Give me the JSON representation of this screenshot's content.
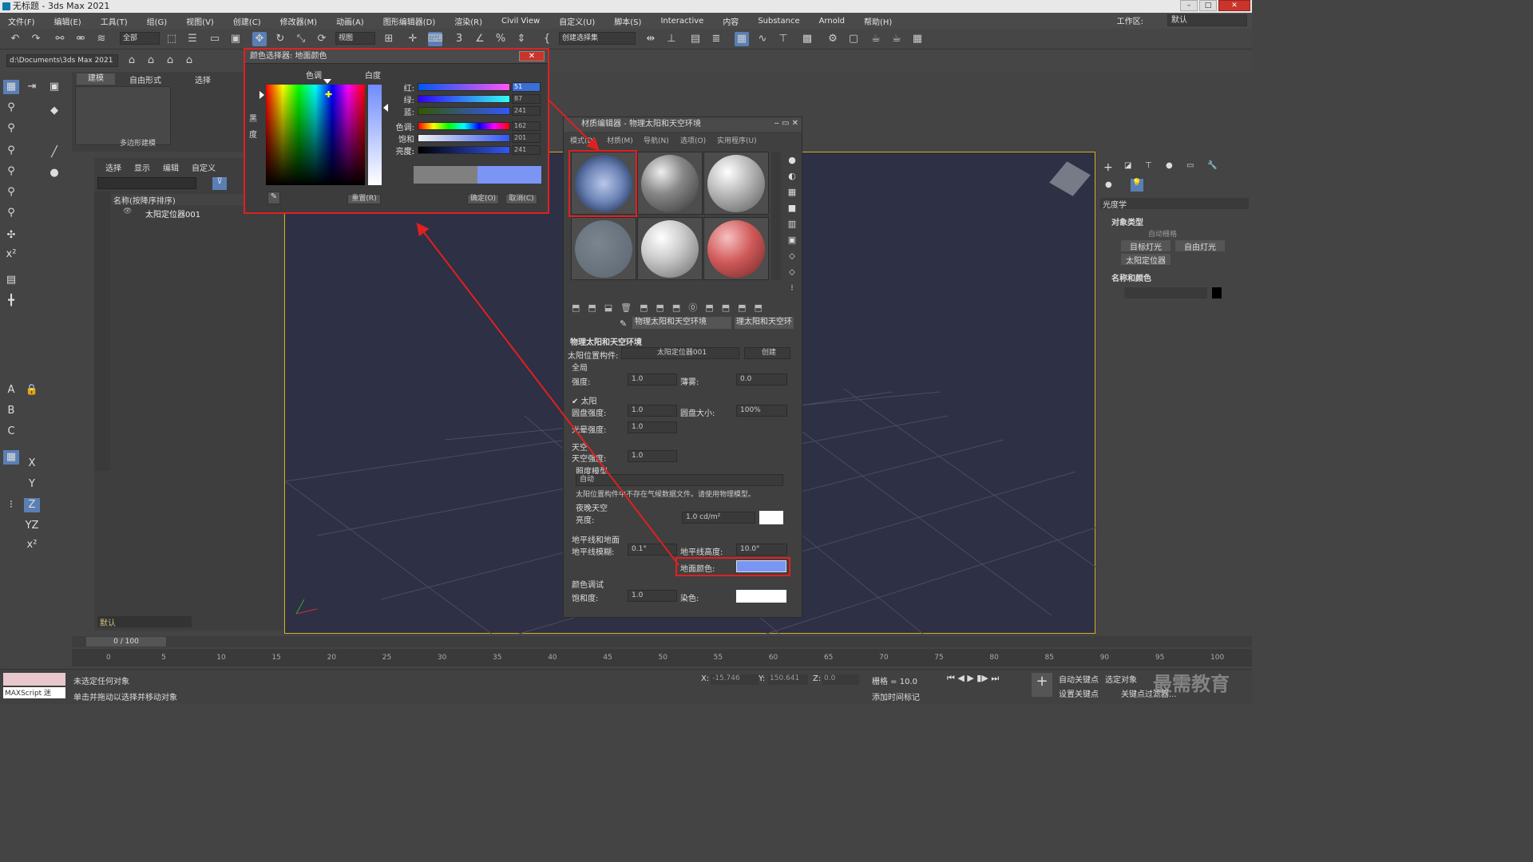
{
  "window": {
    "title": "无标题 - 3ds Max 2021"
  },
  "menu": [
    "文件(F)",
    "编辑(E)",
    "工具(T)",
    "组(G)",
    "视图(V)",
    "创建(C)",
    "修改器(M)",
    "动画(A)",
    "图形编辑器(D)",
    "渲染(R)",
    "Civil View",
    "自定义(U)",
    "脚本(S)",
    "Interactive",
    "内容",
    "Substance",
    "Arnold",
    "帮助(H)"
  ],
  "workspace": {
    "label": "工作区:",
    "value": "默认"
  },
  "toolbar": {
    "filter": "全部",
    "view": "视图",
    "selset": "创建选择集",
    "path": "d:\\Documents\\3ds Max 2021"
  },
  "ribbon": {
    "tabs": [
      "建模",
      "自由形式",
      "选择"
    ],
    "group": "多边形建模"
  },
  "explorer": {
    "tabs": [
      "选择",
      "显示",
      "编辑",
      "自定义"
    ],
    "col": "名称(按降序排序)",
    "item": "太阳定位器001",
    "layer": "默认"
  },
  "color_selector": {
    "title": "颜色选择器: 地面颜色",
    "hue_label": "色调",
    "white_label": "白度",
    "black_label": "黑度",
    "channels": [
      {
        "label": "红:",
        "value": "51"
      },
      {
        "label": "绿:",
        "value": "87"
      },
      {
        "label": "蓝:",
        "value": "241"
      },
      {
        "label": "色调:",
        "value": "162"
      },
      {
        "label": "饱和度:",
        "value": "201"
      },
      {
        "label": "亮度:",
        "value": "241"
      }
    ],
    "reset": "重置(R)",
    "ok": "确定(O)",
    "cancel": "取消(C)",
    "new_color": "#7a95f4"
  },
  "material_editor": {
    "title": "材质编辑器 - 物理太阳和天空环境",
    "tabs": [
      "模式(D)",
      "材质(M)",
      "导航(N)",
      "选项(O)",
      "实用程序(U)"
    ],
    "mat_name": "物理太阳和天空环境",
    "mat_type": "理太阳和天空环",
    "rollout": "物理太阳和天空环境",
    "sun_pos_label": "太阳位置构件:",
    "sun_pos_value": "太阳定位器001",
    "create": "创建",
    "global": "全局",
    "intensity": "强度:",
    "intensity_v": "1.0",
    "haze": "薄雾:",
    "haze_v": "0.0",
    "sun": "太阳",
    "disk_int": "圆盘强度:",
    "disk_int_v": "1.0",
    "disk_size": "圆盘大小:",
    "disk_size_v": "100%",
    "glow": "光晕强度:",
    "glow_v": "1.0",
    "sky": "天空",
    "sky_int": "天空强度:",
    "sky_int_v": "1.0",
    "illum": "照度模型",
    "illum_v": "自动",
    "warning": "太阳位置构件中不存在气候数据文件。请使用物理模型。",
    "night": "夜晚天空",
    "lum": "亮度:",
    "lum_v": "1.0 cd/m²",
    "horizon": "地平线和地面",
    "hblur": "地平线模糊:",
    "hblur_v": "0.1°",
    "hheight": "地平线高度:",
    "hheight_v": "10.0°",
    "ground": "地面颜色:",
    "ground_color": "#7a95f4",
    "tuning": "颜色调试",
    "sat": "饱和度:",
    "sat_v": "1.0",
    "tint": "染色:"
  },
  "cmd": {
    "category": "光度学",
    "objtype": "对象类型",
    "autogrid": "自动栅格",
    "btn1": "目标灯光",
    "btn2": "自由灯光",
    "btn3": "太阳定位器",
    "namecolor": "名称和颜色"
  },
  "timeline": {
    "frame": "0 / 100",
    "ticks": [
      "0",
      "5",
      "10",
      "15",
      "20",
      "25",
      "30",
      "35",
      "40",
      "45",
      "50",
      "55",
      "60",
      "65",
      "70",
      "75",
      "80",
      "85",
      "90",
      "95",
      "100"
    ]
  },
  "status": {
    "line1": "未选定任何对象",
    "line2": "单击并拖动以选择并移动对象",
    "x": "-15.746",
    "y": "150.641",
    "z": "0.0",
    "grid": "栅格 = 10.0",
    "addtime": "添加时间标记",
    "autokey": "自动关键点",
    "setkey": "设置关键点",
    "selected": "选定对象",
    "keyfilter": "关键点过滤器...",
    "script": "MAXScript 迷",
    "watermark": "最需教育"
  }
}
